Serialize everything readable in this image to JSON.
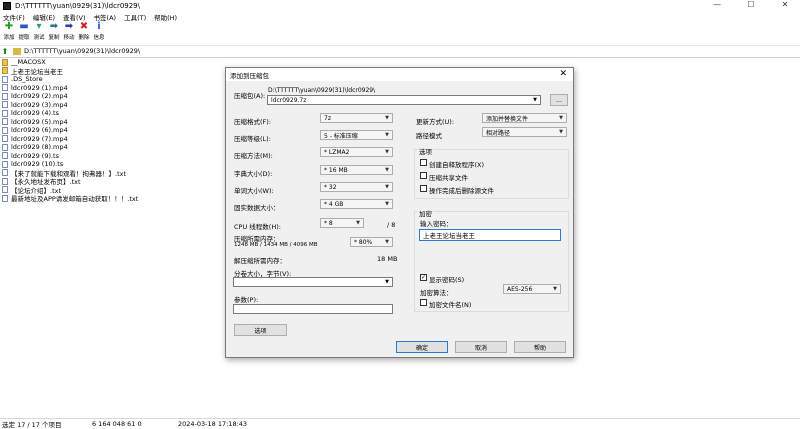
{
  "window": {
    "title": "D:\\TTTTTT\\yuan\\0929(31)\\ldcr0929\\",
    "controls": [
      "—",
      "☐",
      "✕"
    ]
  },
  "menu": [
    "文件(F)",
    "编辑(E)",
    "查看(V)",
    "书签(A)",
    "工具(T)",
    "帮助(H)"
  ],
  "toolbar": [
    {
      "label": "添加",
      "icon": "add-icon",
      "glyph": "✚",
      "color": "#1f9d1f"
    },
    {
      "label": "提取",
      "icon": "extract-icon",
      "glyph": "▬",
      "color": "#2b55c9"
    },
    {
      "label": "测试",
      "icon": "test-icon",
      "glyph": "▾",
      "color": "#2c9a8c"
    },
    {
      "label": "复制",
      "icon": "copy-icon",
      "glyph": "➡",
      "color": "#1f7a8c"
    },
    {
      "label": "移动",
      "icon": "move-icon",
      "glyph": "➡",
      "color": "#2b3fa8"
    },
    {
      "label": "删除",
      "icon": "delete-icon",
      "glyph": "✖",
      "color": "#d22020"
    },
    {
      "label": "信息",
      "icon": "info-icon",
      "glyph": "i",
      "color": "#2b55c9"
    }
  ],
  "address": {
    "path": "D:\\TTTTTT\\yuan\\0929(31)\\ldcr0929\\"
  },
  "files": [
    {
      "name": "__MACOSX",
      "type": "folder"
    },
    {
      "name": "上老王论坛当老王",
      "type": "folder"
    },
    {
      "name": ".DS_Store",
      "type": "file"
    },
    {
      "name": "ldcr0929 (1).mp4",
      "type": "file"
    },
    {
      "name": "ldcr0929 (2).mp4",
      "type": "file"
    },
    {
      "name": "ldcr0929 (3).mp4",
      "type": "file"
    },
    {
      "name": "ldcr0929 (4).ts",
      "type": "file"
    },
    {
      "name": "ldcr0929 (5).mp4",
      "type": "file"
    },
    {
      "name": "ldcr0929 (6).mp4",
      "type": "file"
    },
    {
      "name": "ldcr0929 (7).mp4",
      "type": "file"
    },
    {
      "name": "ldcr0929 (8).mp4",
      "type": "file"
    },
    {
      "name": "ldcr0929 (9).ts",
      "type": "file"
    },
    {
      "name": "ldcr0929 (10).ts",
      "type": "file"
    },
    {
      "name": "【来了就能下载和观看！拘弗器！】.txt",
      "type": "file"
    },
    {
      "name": "【永久地址发布页】.txt",
      "type": "file"
    },
    {
      "name": "【论坛介绍】.txt",
      "type": "file"
    },
    {
      "name": "最新地址及APP请发邮箱自动获取！！！.txt",
      "type": "file"
    }
  ],
  "status": {
    "selection": "选定 17 / 17 个项目",
    "size": "6 164 048 61 0",
    "date": "2024-03-18 17:18:43"
  },
  "dialog": {
    "title": "添加到压缩包",
    "close": "✕",
    "archive_label": "压缩包(A):",
    "archive_dir": "D:\\TTTTTT\\yuan\\0929(31)\\ldcr0929\\",
    "archive_name": "ldcr0929.7z",
    "browse": "...",
    "format_label": "压缩格式(F):",
    "format_value": "7z",
    "level_label": "压缩等级(L):",
    "level_value": "5 - 标准压缩",
    "method_label": "压缩方法(M):",
    "method_value": "* LZMA2",
    "dict_label": "字典大小(D):",
    "dict_value": "* 16 MB",
    "word_label": "单词大小(W):",
    "word_value": "* 32",
    "solid_label": "固实数据大小：",
    "solid_value": "* 4 GB",
    "cpu_label": "CPU 线程数(H):",
    "cpu_value": "* 8",
    "cpu_total": "/ 8",
    "mem_label": "压缩所需内存：",
    "mem_detail": "1248 MB / 1434 MB / 4096 MB",
    "mem_value": "* 80%",
    "decomp_label": "解压缩所需内存：",
    "decomp_value": "18 MB",
    "split_label": "分卷大小，字节(V):",
    "params_label": "参数(P):",
    "options_button": "选项",
    "update_label": "更新方式(U):",
    "update_value": "添加并替换文件",
    "pathmode_label": "路径模式",
    "pathmode_value": "相对路径",
    "options_group": "选项",
    "opt_sfx": "创建自释放程序(X)",
    "opt_shared": "压缩共享文件",
    "opt_delete": "操作完成后删除源文件",
    "enc_group": "加密",
    "pwd_label": "输入密码：",
    "pwd_value": "上老王论坛当老王",
    "show_pwd": "显示密码(S)",
    "enc_method_label": "加密算法：",
    "enc_method_value": "AES-256",
    "enc_names": "加密文件名(N)",
    "ok": "确定",
    "cancel": "取消",
    "help": "帮助"
  }
}
